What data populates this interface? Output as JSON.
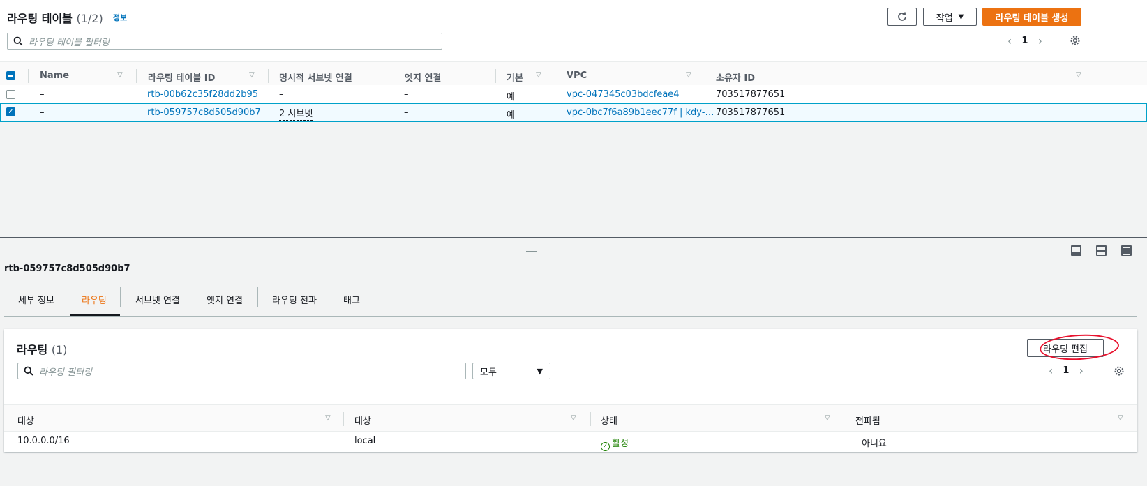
{
  "header": {
    "title": "라우팅 테이블",
    "count": "(1/2)",
    "info_link": "정보",
    "actions_label": "작업",
    "create_label": "라우팅 테이블 생성"
  },
  "search": {
    "placeholder": "라우팅 테이블 필터링"
  },
  "pagination": {
    "page": "1"
  },
  "table": {
    "columns": [
      "Name",
      "라우팅 테이블 ID",
      "명시적 서브넷 연결",
      "엣지 연결",
      "기본",
      "VPC",
      "소유자 ID"
    ],
    "rows": [
      {
        "name": "–",
        "id": "rtb-00b62c35f28dd2b95",
        "subnet": "–",
        "edge": "–",
        "main": "예",
        "vpc": "vpc-047345c03bdcfeae4",
        "owner": "703517877651",
        "selected": false
      },
      {
        "name": "–",
        "id": "rtb-059757c8d505d90b7",
        "subnet": "2 서브넷",
        "edge": "–",
        "main": "예",
        "vpc": "vpc-0bc7f6a89b1eec77f | kdy-…",
        "owner": "703517877651",
        "selected": true
      }
    ]
  },
  "detail": {
    "title": "rtb-059757c8d505d90b7",
    "tabs": [
      "세부 정보",
      "라우팅",
      "서브넷 연결",
      "엣지 연결",
      "라우팅 전파",
      "태그"
    ],
    "active_tab": 1
  },
  "routes": {
    "title": "라우팅",
    "count": "(1)",
    "edit_label": "라우팅 편집",
    "search_placeholder": "라우팅 필터링",
    "filter_value": "모두",
    "page": "1",
    "columns": [
      "대상",
      "대상",
      "상태",
      "전파됨"
    ],
    "rows": [
      {
        "destination": "10.0.0.0/16",
        "target": "local",
        "status": "활성",
        "propagated": "아니요"
      }
    ]
  },
  "colors": {
    "primary": "#ec7211",
    "link": "#0073bb",
    "success": "#1d8102",
    "annotation": "#e8112d"
  }
}
